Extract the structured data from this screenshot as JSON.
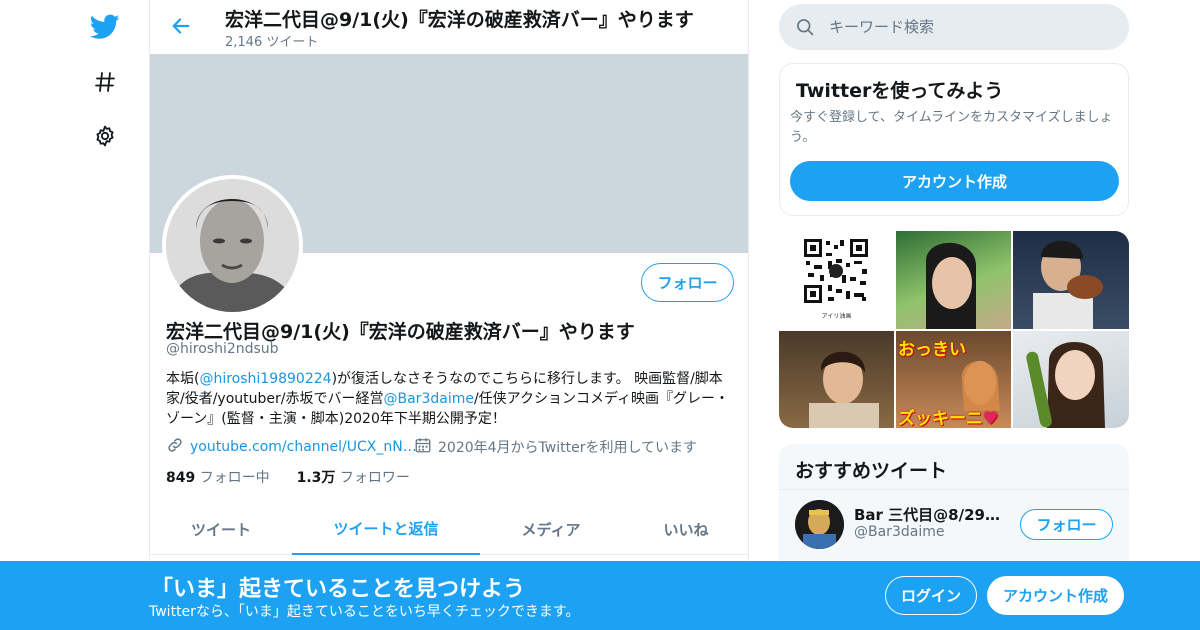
{
  "nav": {
    "icons": [
      "twitter-bird-icon",
      "hashtag-icon",
      "gear-icon"
    ]
  },
  "header": {
    "title": "宏洋二代目@9/1(火)『宏洋の破産救済バー』やります",
    "tweet_count": "2,146 ツイート"
  },
  "profile": {
    "name": "宏洋二代目@9/1(火)『宏洋の破産救済バー』やります",
    "handle": "@hiroshi2ndsub",
    "follow_label": "フォロー",
    "bio": {
      "p1": "本垢(",
      "link1": "@hiroshi19890224",
      "p2": ")が復活しなさそうなのでこちらに移行します。 映画監督/脚本家/役者/youtuber/赤坂でバー経営",
      "link2": "@Bar3daime",
      "p3": "/任侠アクションコメディ映画『グレー・ゾーン』(監督・主演・脚本)2020年下半期公開予定！"
    },
    "website": "youtube.com/channel/UCX_nN…",
    "joined": "2020年4月からTwitterを利用しています",
    "following_count": "849",
    "following_label": "フォロー中",
    "followers_count": "1.3万",
    "followers_label": "フォロワー"
  },
  "tabs": [
    {
      "label": "ツイート",
      "active": false
    },
    {
      "label": "ツイートと返信",
      "active": true
    },
    {
      "label": "メディア",
      "active": false
    },
    {
      "label": "いいね",
      "active": false
    }
  ],
  "search": {
    "placeholder": "キーワード検索"
  },
  "try_card": {
    "title": "Twitterを使ってみよう",
    "description": "今すぐ登録して、タイムラインをカスタマイズしましょう。",
    "button": "アカウント作成"
  },
  "media": {
    "qr_caption": "アイリ油画",
    "overlay_top": "おっきい",
    "overlay_bottom": "ズッキーニ"
  },
  "recommended": {
    "title": "おすすめツイート",
    "user_name": "Bar 三代目@8/29み…",
    "user_handle": "@Bar3daime",
    "follow_label": "フォロー"
  },
  "bottom_bar": {
    "title": "「いま」起きていることを見つけよう",
    "subtitle": "Twitterなら、「いま」起きていることをいち早くチェックできます。",
    "login": "ログイン",
    "signup": "アカウント作成"
  },
  "colors": {
    "accent": "#1da1f2",
    "banner": "#ccd6dd",
    "text_secondary": "#657786"
  }
}
